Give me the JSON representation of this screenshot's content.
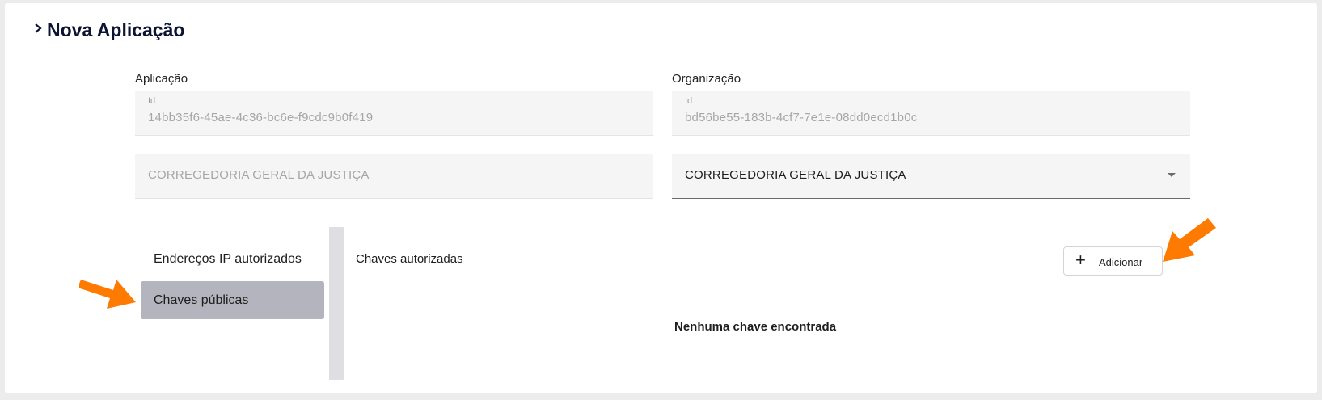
{
  "page": {
    "title": "Nova Aplicação"
  },
  "aplicacao": {
    "section_label": "Aplicação",
    "id_label": "Id",
    "id_value": "14bb35f6-45ae-4c36-bc6e-f9cdc9b0f419",
    "name_value": "CORREGEDORIA GERAL DA JUSTIÇA"
  },
  "organizacao": {
    "section_label": "Organização",
    "id_label": "Id",
    "id_value": "bd56be55-183b-4cf7-7e1e-08dd0ecd1b0c",
    "select_value": "CORREGEDORIA GERAL DA JUSTIÇA"
  },
  "nav": {
    "items": [
      {
        "label": "Endereços IP autorizados",
        "active": false
      },
      {
        "label": "Chaves públicas",
        "active": true
      }
    ]
  },
  "panel": {
    "title": "Chaves autorizadas",
    "add_label": "Adicionar",
    "empty_message": "Nenhuma chave encontrada"
  },
  "colors": {
    "title": "#0d1433",
    "nav_active": "#b3b4bd",
    "annotation_arrow": "#ff7a00"
  },
  "icons": [
    "chevron-right-icon",
    "chevron-down-icon",
    "plus-icon",
    "annotation-arrow-icon"
  ]
}
